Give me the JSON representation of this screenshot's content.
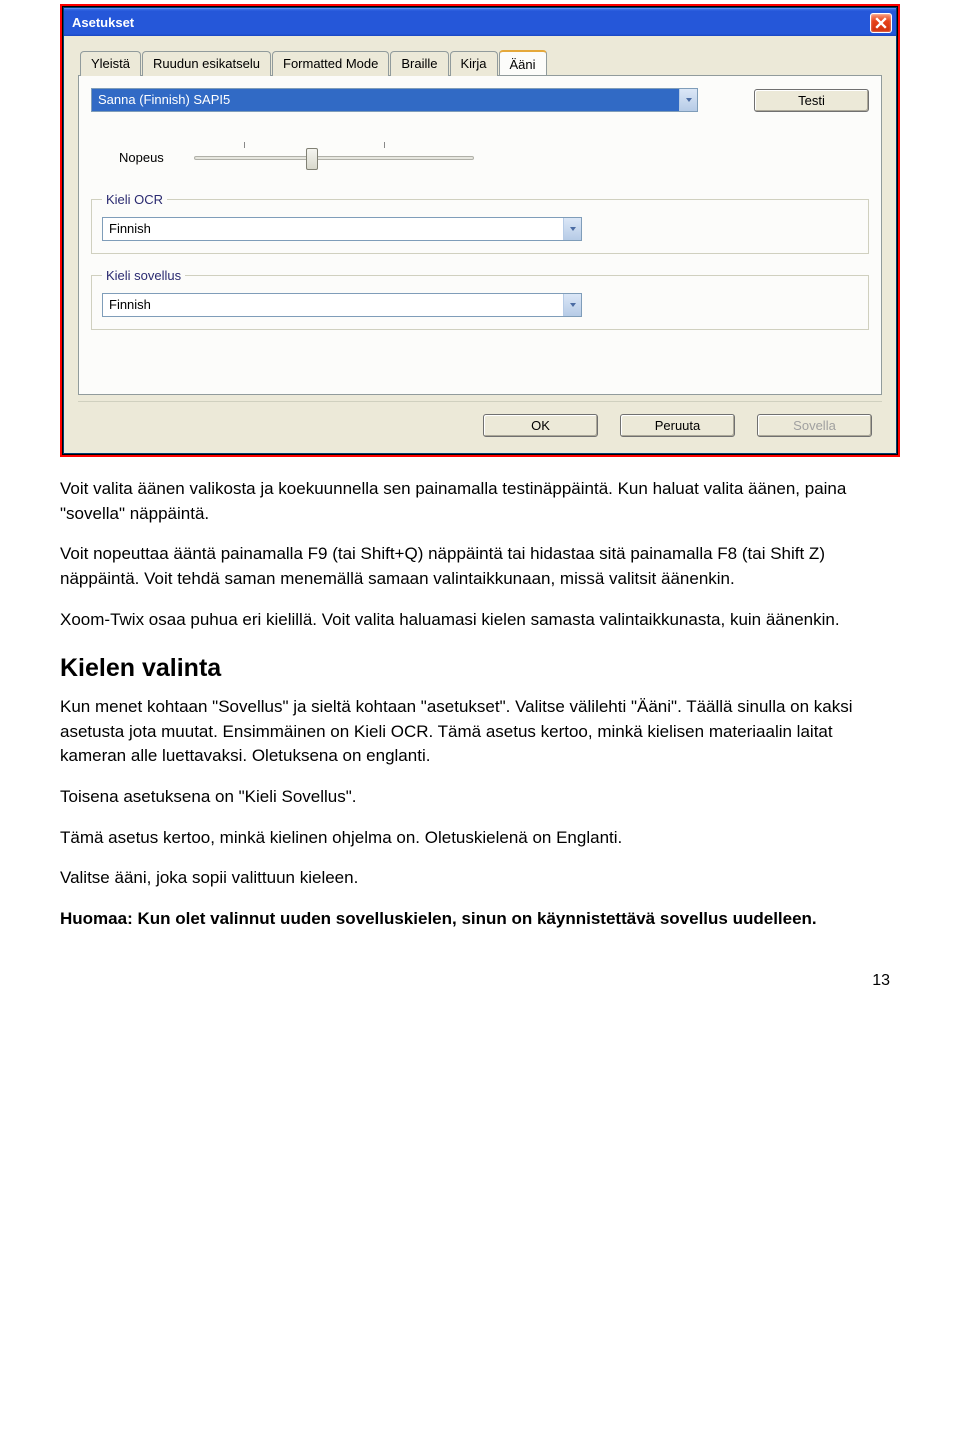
{
  "dialog": {
    "title": "Asetukset",
    "tabs": [
      "Yleistä",
      "Ruudun esikatselu",
      "Formatted Mode",
      "Braille",
      "Kirja",
      "Ääni"
    ],
    "active_tab_index": 5,
    "voice_select": "Sanna (Finnish) SAPI5",
    "test_button": "Testi",
    "speed_label": "Nopeus",
    "ocr_group": "Kieli OCR",
    "ocr_value": "Finnish",
    "app_group": "Kieli sovellus",
    "app_value": "Finnish",
    "buttons": {
      "ok": "OK",
      "cancel": "Peruuta",
      "apply": "Sovella"
    }
  },
  "doc": {
    "p1": "Voit valita äänen valikosta ja koekuunnella sen painamalla testinäppäintä. Kun haluat valita äänen, paina \"sovella\" näppäintä.",
    "p2": "Voit nopeuttaa ääntä painamalla F9 (tai Shift+Q) näppäintä tai hidastaa sitä painamalla F8 (tai Shift Z) näppäintä. Voit tehdä saman menemällä samaan valintaikkunaan, missä valitsit äänenkin.",
    "p3": "Xoom-Twix osaa puhua eri kielillä. Voit valita haluamasi kielen samasta valintaikkunasta, kuin äänenkin.",
    "h2": "Kielen valinta",
    "p4": "Kun menet kohtaan \"Sovellus\" ja sieltä kohtaan \"asetukset\". Valitse välilehti \"Ääni\". Täällä sinulla on kaksi asetusta jota muutat. Ensimmäinen on Kieli OCR. Tämä asetus kertoo, minkä kielisen materiaalin laitat kameran alle luettavaksi. Oletuksena on englanti.",
    "p5": "Toisena asetuksena on \"Kieli Sovellus\".",
    "p6": "Tämä asetus kertoo, minkä kielinen ohjelma on. Oletuskielenä on Englanti.",
    "p7": "Valitse ääni, joka sopii valittuun kieleen.",
    "p8": "Huomaa: Kun olet valinnut uuden sovelluskielen, sinun on käynnistettävä sovellus uudelleen.",
    "page_number": "13"
  }
}
